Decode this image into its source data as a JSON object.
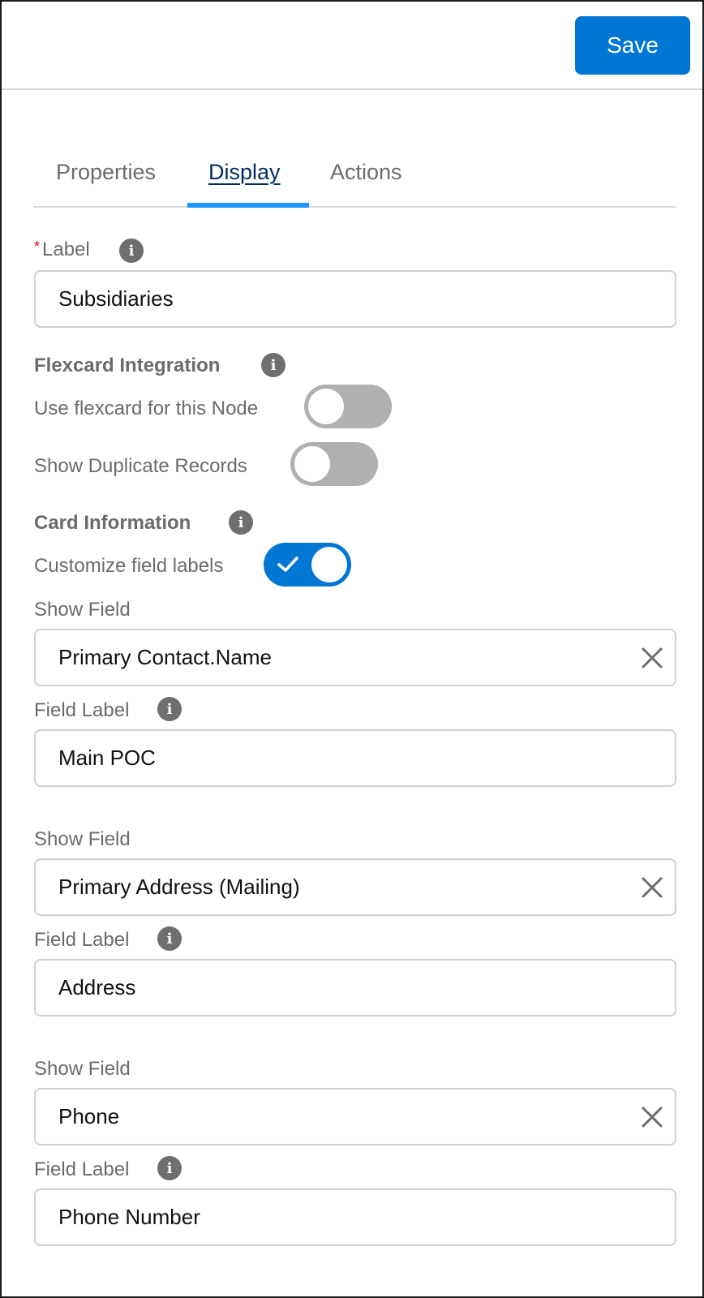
{
  "header": {
    "save_label": "Save"
  },
  "tabs": [
    {
      "label": "Properties",
      "active": false
    },
    {
      "label": "Display",
      "active": true
    },
    {
      "label": "Actions",
      "active": false
    }
  ],
  "label_field": {
    "required_marker": "*",
    "label": "Label",
    "value": "Subsidiaries"
  },
  "flexcard": {
    "heading": "Flexcard Integration",
    "use_flexcard": {
      "label": "Use flexcard for this Node",
      "checked": false
    },
    "show_duplicates": {
      "label": "Show Duplicate Records",
      "checked": false
    }
  },
  "card_info": {
    "heading": "Card Information",
    "customize_labels": {
      "label": "Customize field labels",
      "checked": true
    }
  },
  "fields": [
    {
      "show_field_label": "Show Field",
      "show_field_value": "Primary Contact.Name",
      "field_label_label": "Field Label",
      "field_label_value": "Main POC"
    },
    {
      "show_field_label": "Show Field",
      "show_field_value": "Primary Address (Mailing)",
      "field_label_label": "Field Label",
      "field_label_value": "Address"
    },
    {
      "show_field_label": "Show Field",
      "show_field_value": "Phone",
      "field_label_label": "Field Label",
      "field_label_value": "Phone Number"
    }
  ],
  "icons": {
    "info": "info-icon",
    "clear": "close-icon",
    "check": "check-icon"
  },
  "colors": {
    "brand": "#0176d3",
    "tab_indicator": "#1b96ff",
    "required": "#ea001e"
  }
}
